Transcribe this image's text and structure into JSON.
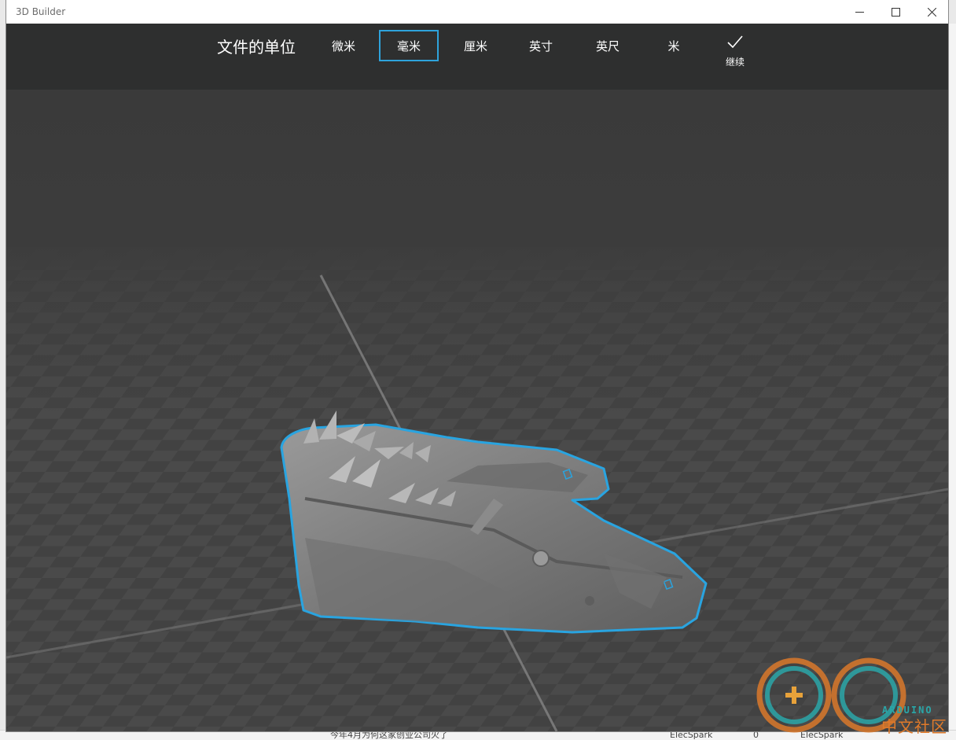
{
  "window": {
    "title": "3D Builder"
  },
  "units_toolbar": {
    "heading": "文件的单位",
    "options": [
      {
        "label": "微米",
        "selected": false
      },
      {
        "label": "毫米",
        "selected": true
      },
      {
        "label": "厘米",
        "selected": false
      },
      {
        "label": "英寸",
        "selected": false
      },
      {
        "label": "英尺",
        "selected": false
      },
      {
        "label": "米",
        "selected": false
      }
    ],
    "continue_label": "继续"
  },
  "colors": {
    "accent": "#2ea3dc",
    "toolbar_bg": "#2e2f2f",
    "viewport_bg": "#3b3b3b"
  },
  "watermark": {
    "text": "中文社区",
    "sub_text": "ARDUINO"
  },
  "background_strip": {
    "cells": [
      "今年4月为何这家创业公司火了",
      "ElecSpark",
      "0",
      "ElecSpark"
    ]
  }
}
